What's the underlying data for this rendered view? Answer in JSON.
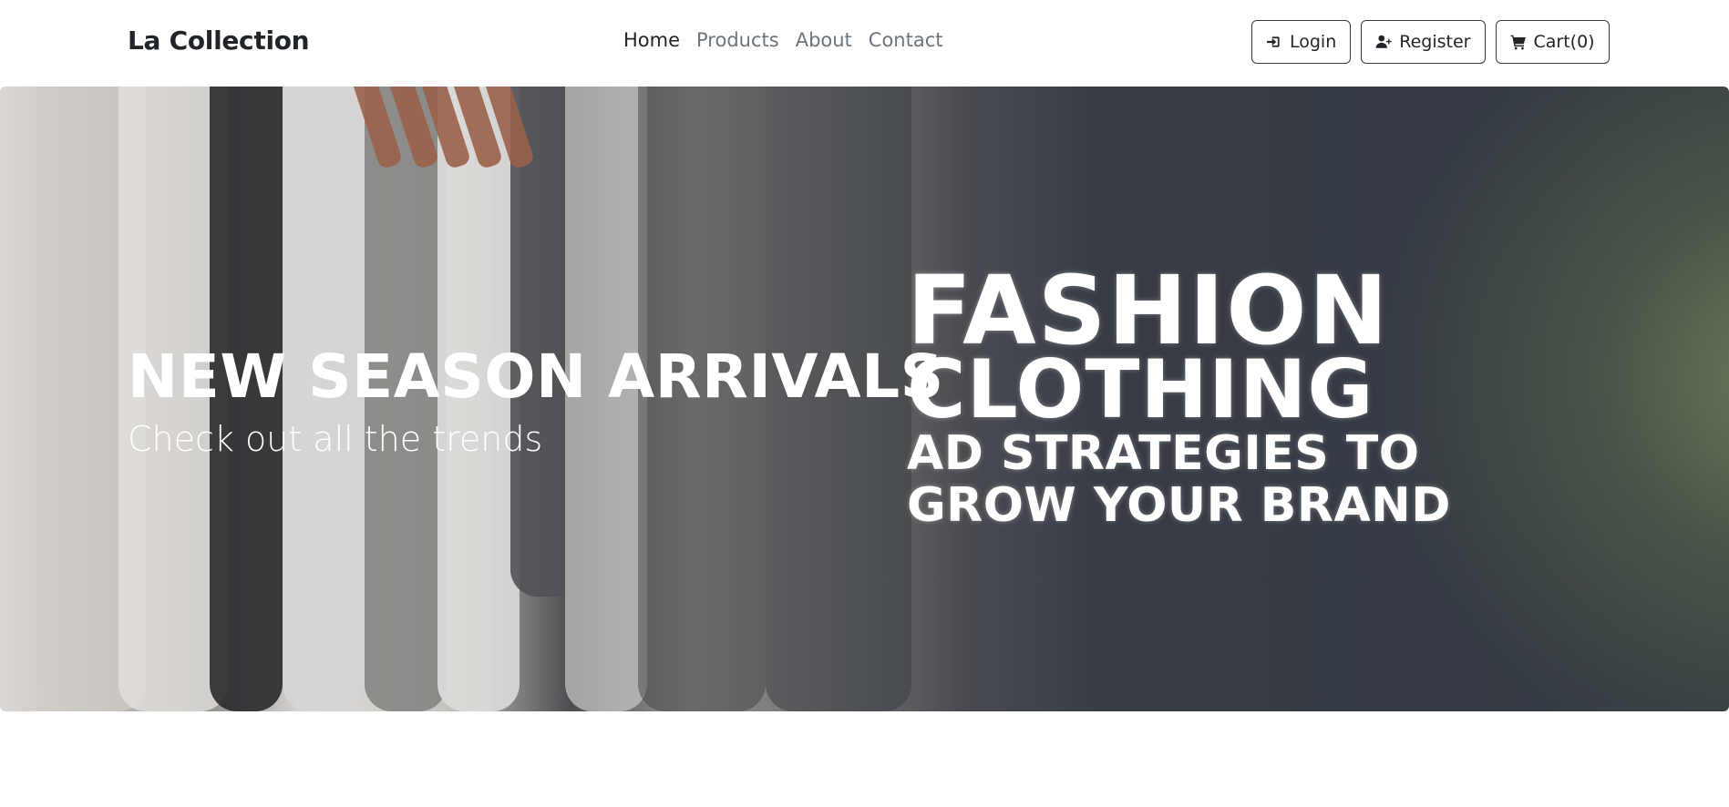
{
  "navbar": {
    "brand": "La Collection",
    "links": [
      {
        "label": "Home",
        "active": true
      },
      {
        "label": "Products",
        "active": false
      },
      {
        "label": "About",
        "active": false
      },
      {
        "label": "Contact",
        "active": false
      }
    ],
    "buttons": {
      "login": {
        "label": "Login",
        "icon": "sign-in-icon"
      },
      "register": {
        "label": "Register",
        "icon": "user-plus-icon"
      },
      "cart": {
        "label": "Cart(0)",
        "icon": "shopping-cart-icon"
      }
    }
  },
  "hero": {
    "title": "NEW SEASON ARRIVALS",
    "subtitle": "Check out all the trends",
    "ad": {
      "line1": "FASHION",
      "line2": "CLOTHING",
      "line3": "AD STRATEGIES TO",
      "line4": "GROW YOUR BRAND"
    }
  },
  "colors": {
    "text_dark": "#212529",
    "text_muted": "#6c757d",
    "hero_dark": "#343a43",
    "hero_accent": "#6b7a5a"
  }
}
